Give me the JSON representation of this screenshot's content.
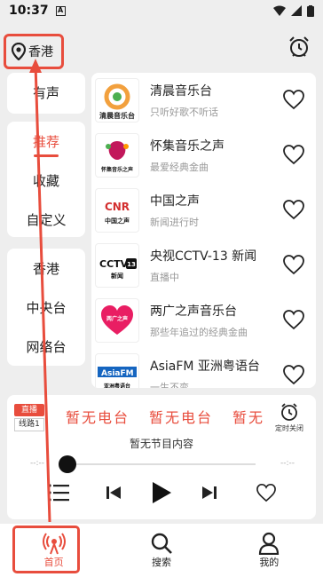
{
  "status": {
    "time": "10:37",
    "badge": "A"
  },
  "header": {
    "location": "香港"
  },
  "categories_top": [
    {
      "label": "有声"
    }
  ],
  "categories_mid": [
    {
      "label": "推荐"
    },
    {
      "label": "收藏"
    },
    {
      "label": "自定义"
    }
  ],
  "categories_region": [
    {
      "label": "香港"
    },
    {
      "label": "中央台"
    },
    {
      "label": "网络台"
    }
  ],
  "stations": [
    {
      "name": "清晨音乐台",
      "sub": "只听好歌不听话",
      "logo": "清晨音乐台"
    },
    {
      "name": "怀集音乐之声",
      "sub": "最爱经典金曲",
      "logo": "怀集音乐之声"
    },
    {
      "name": "中国之声",
      "sub": "新闻进行时",
      "logo": "CNR 中国之声"
    },
    {
      "name": "央视CCTV-13 新闻",
      "sub": "直播中",
      "logo": "CCTV 13 新闻"
    },
    {
      "name": "两广之声音乐台",
      "sub": "那些年追过的经典金曲",
      "logo": "两广之声"
    },
    {
      "name": "AsiaFM 亚洲粤语台",
      "sub": "一生不变",
      "logo": "AsiaFM 亚洲粤语台"
    }
  ],
  "player": {
    "live": "直播",
    "line": "线路1",
    "marquee": [
      "暂无电台",
      "暂无电台",
      "暂无"
    ],
    "timer": "定时关闭",
    "program": "暂无节目内容",
    "time_left": "--:--",
    "time_right": "--:--"
  },
  "nav": [
    {
      "label": "首页"
    },
    {
      "label": "搜索"
    },
    {
      "label": "我的"
    }
  ],
  "colors": {
    "accent": "#e84d3d"
  }
}
